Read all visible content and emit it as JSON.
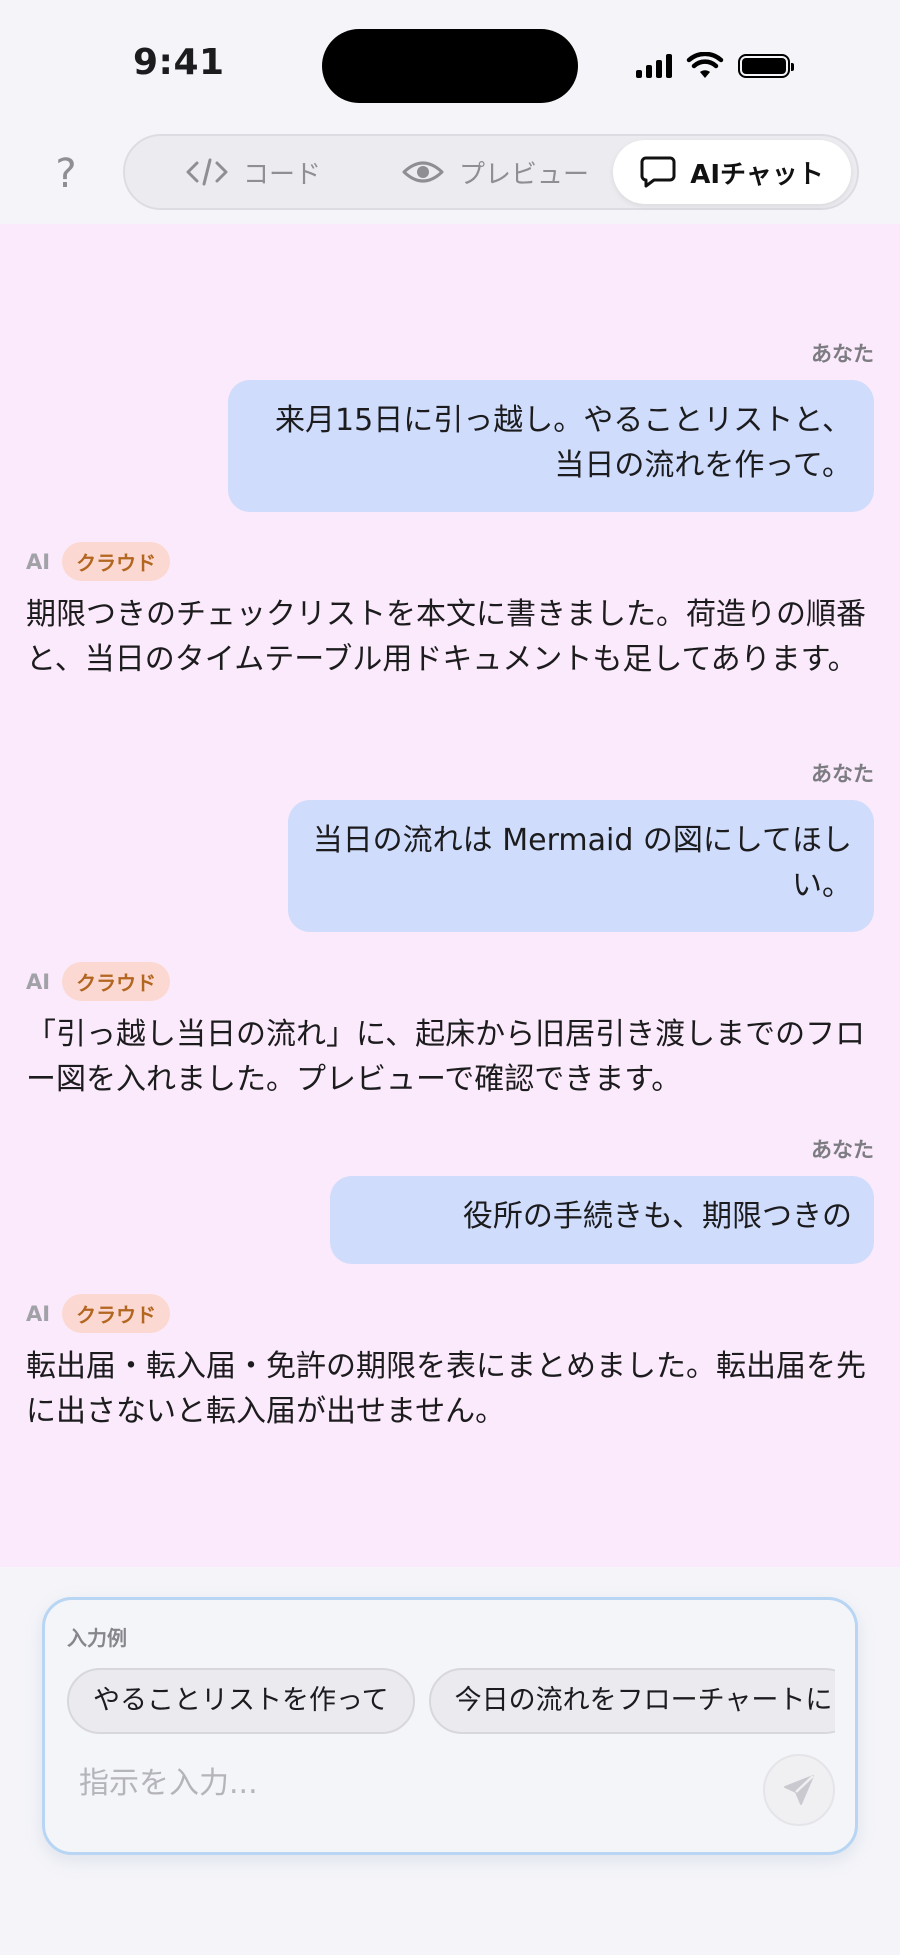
{
  "status": {
    "time": "9:41"
  },
  "tabs": {
    "help": "?",
    "code": "コード",
    "preview": "プレビュー",
    "chat": "AIチャット"
  },
  "messages": [
    {
      "role": "user",
      "label": "あなた",
      "text": "来月15日に引っ越し。やることリストと、当日の流れを作って。"
    },
    {
      "role": "ai",
      "tag": "AI",
      "badge": "クラウド",
      "text": "期限つきのチェックリストを本文に書きました。荷造りの順番と、当日のタイムテーブル用ドキュメントも足してあります。"
    },
    {
      "role": "user",
      "label": "あなた",
      "text": "当日の流れは Mermaid の図にしてほしい。"
    },
    {
      "role": "ai",
      "tag": "AI",
      "badge": "クラウド",
      "text": "「引っ越し当日の流れ」に、起床から旧居引き渡しまでのフロー図を入れました。プレビューで確認できます。"
    },
    {
      "role": "user",
      "label": "あなた",
      "text": "役所の手続きも、期限つきの"
    },
    {
      "role": "ai",
      "tag": "AI",
      "badge": "クラウド",
      "text": "転出届・転入届・免許の期限を表にまとめました。転出届を先に出さないと転入届が出せません。"
    }
  ],
  "composer": {
    "examples_label": "入力例",
    "examples": [
      "やることリストを作って",
      "今日の流れをフローチャートに"
    ],
    "placeholder": "指示を入力..."
  }
}
